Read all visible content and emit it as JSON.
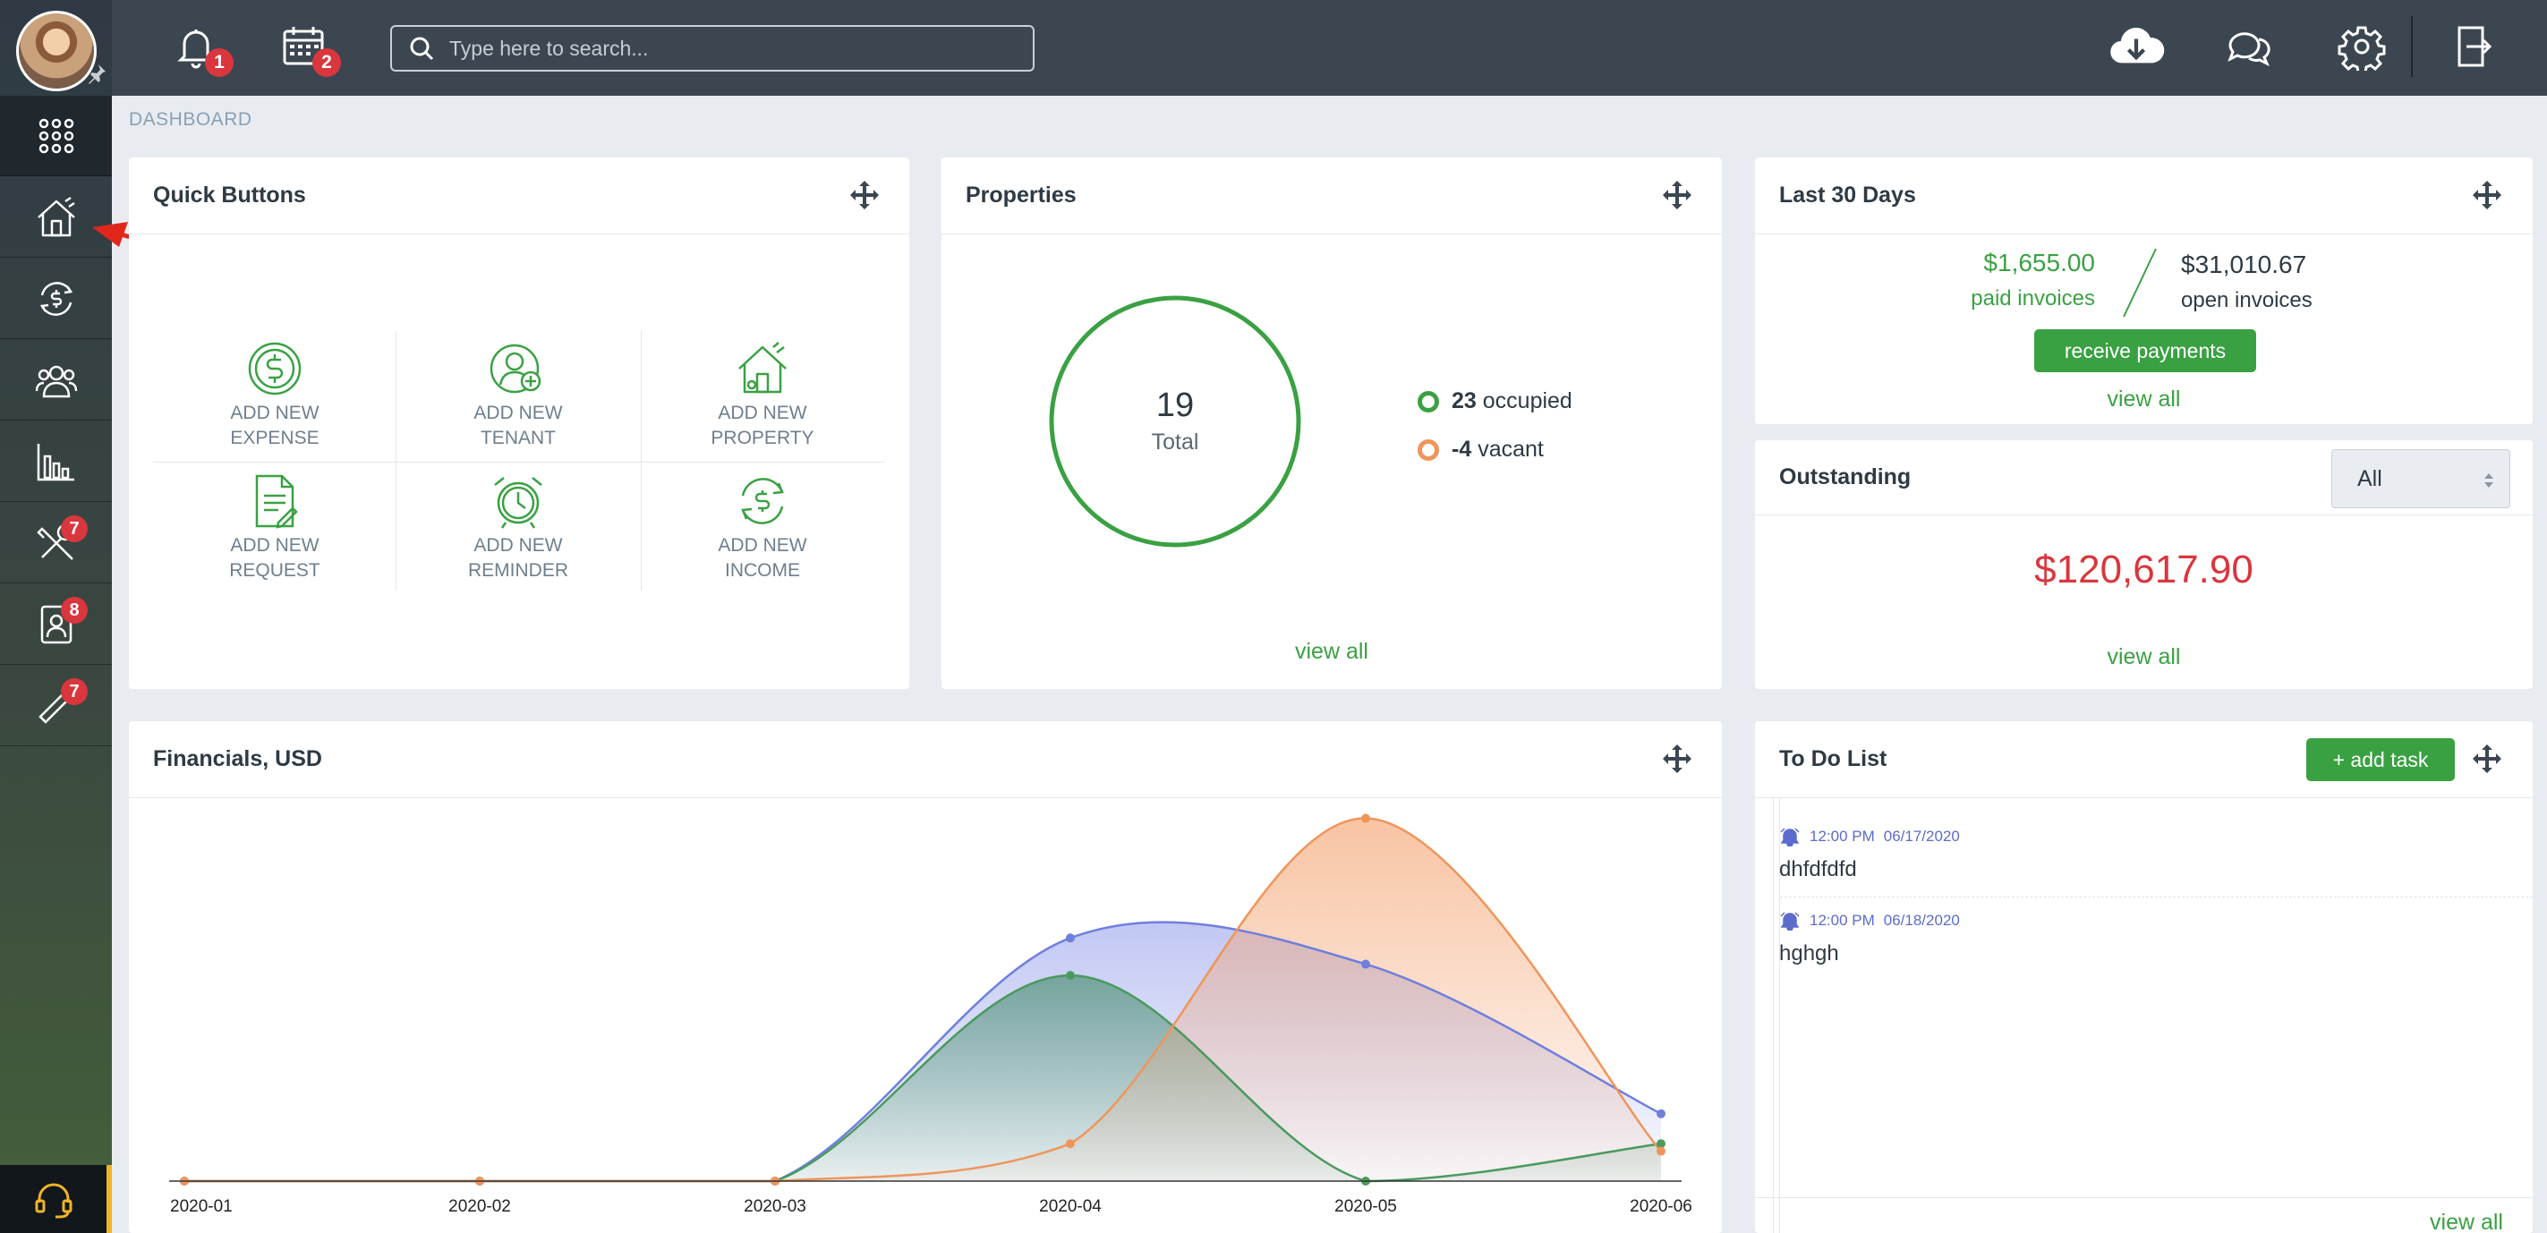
{
  "topbar": {
    "notifications_badge": "1",
    "calendar_badge": "2",
    "search_placeholder": "Type here to search..."
  },
  "sidebar": {
    "badges": {
      "maintenance": "7",
      "contacts": "8",
      "marketing": "7"
    }
  },
  "breadcrumb": "DASHBOARD",
  "quick_buttons": {
    "title": "Quick Buttons",
    "items": [
      {
        "line1": "ADD NEW",
        "line2": "EXPENSE",
        "icon": "dollar-coin-icon"
      },
      {
        "line1": "ADD NEW",
        "line2": "TENANT",
        "icon": "add-user-icon"
      },
      {
        "line1": "ADD NEW",
        "line2": "PROPERTY",
        "icon": "house-icon"
      },
      {
        "line1": "ADD NEW",
        "line2": "REQUEST",
        "icon": "document-icon"
      },
      {
        "line1": "ADD NEW",
        "line2": "REMINDER",
        "icon": "alarm-clock-icon"
      },
      {
        "line1": "ADD NEW",
        "line2": "INCOME",
        "icon": "money-cycle-icon"
      }
    ]
  },
  "properties": {
    "title": "Properties",
    "total_value": "19",
    "total_label": "Total",
    "occupied_value": "23",
    "occupied_label": "occupied",
    "vacant_value": "-4",
    "vacant_label": "vacant",
    "view_all": "view all",
    "colors": {
      "occupied": "#3aa143",
      "vacant": "#f0955a"
    }
  },
  "last30": {
    "title": "Last 30 Days",
    "paid_amount": "$1,655.00",
    "paid_label": "paid invoices",
    "open_amount": "$31,010.67",
    "open_label": "open invoices",
    "button": "receive payments",
    "view_all": "view all"
  },
  "outstanding": {
    "title": "Outstanding",
    "filter_value": "All",
    "amount": "$120,617.90",
    "view_all": "view all"
  },
  "financials": {
    "title": "Financials, USD"
  },
  "todo": {
    "title": "To Do List",
    "add_button": "+ add task",
    "view_all": "view all",
    "items": [
      {
        "time": "12:00 PM",
        "date": "06/17/2020",
        "text": "dhfdfdfd"
      },
      {
        "time": "12:00 PM",
        "date": "06/18/2020",
        "text": "hghgh"
      }
    ]
  },
  "chart_data": {
    "type": "area",
    "title": "Financials, USD",
    "x": [
      "2020-01",
      "2020-02",
      "2020-03",
      "2020-04",
      "2020-05",
      "2020-06"
    ],
    "series": [
      {
        "values": [
          0,
          0,
          0,
          0.65,
          0.58,
          0.18
        ],
        "color": "#6f7fdc"
      },
      {
        "values": [
          0,
          0,
          0,
          0.55,
          0,
          0.1
        ],
        "color": "#4a9a5e"
      },
      {
        "values": [
          0,
          0,
          0,
          0.1,
          0.97,
          0.08
        ],
        "color": "#f0955a"
      }
    ],
    "ylim": [
      0,
      1
    ],
    "grid": false,
    "legend": "none"
  }
}
